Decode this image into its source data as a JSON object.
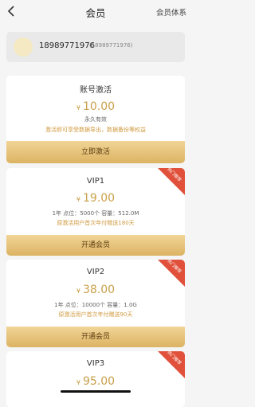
{
  "nav": {
    "title": "会员",
    "right": "会员体系"
  },
  "user": {
    "phone": "18989771976",
    "phone_sub": "(18989771976)"
  },
  "activation": {
    "title": "账号激活",
    "currency": "¥",
    "price": "10.00",
    "validity": "永久有效",
    "note": "激活即可享受数据导出，数据备份等权益",
    "button": "立即激活"
  },
  "plans": [
    {
      "title": "VIP1",
      "currency": "¥",
      "price": "19.00",
      "detail": "1年  点位：5000个  容量：512.0M",
      "gift": "原激活用户首次年付赠送180天",
      "button": "开通会员",
      "tag": "热门推荐"
    },
    {
      "title": "VIP2",
      "currency": "¥",
      "price": "38.00",
      "detail": "1年  点位：10000个  容量：1.0G",
      "gift": "原激活用户首次年付赠送90天",
      "button": "开通会员",
      "tag": "热门推荐"
    },
    {
      "title": "VIP3",
      "currency": "¥",
      "price": "95.00",
      "tag": "热门推荐"
    }
  ],
  "colors": {
    "accent": "#c9a04a",
    "tag": "#e0503a",
    "button": "#dcb363"
  }
}
